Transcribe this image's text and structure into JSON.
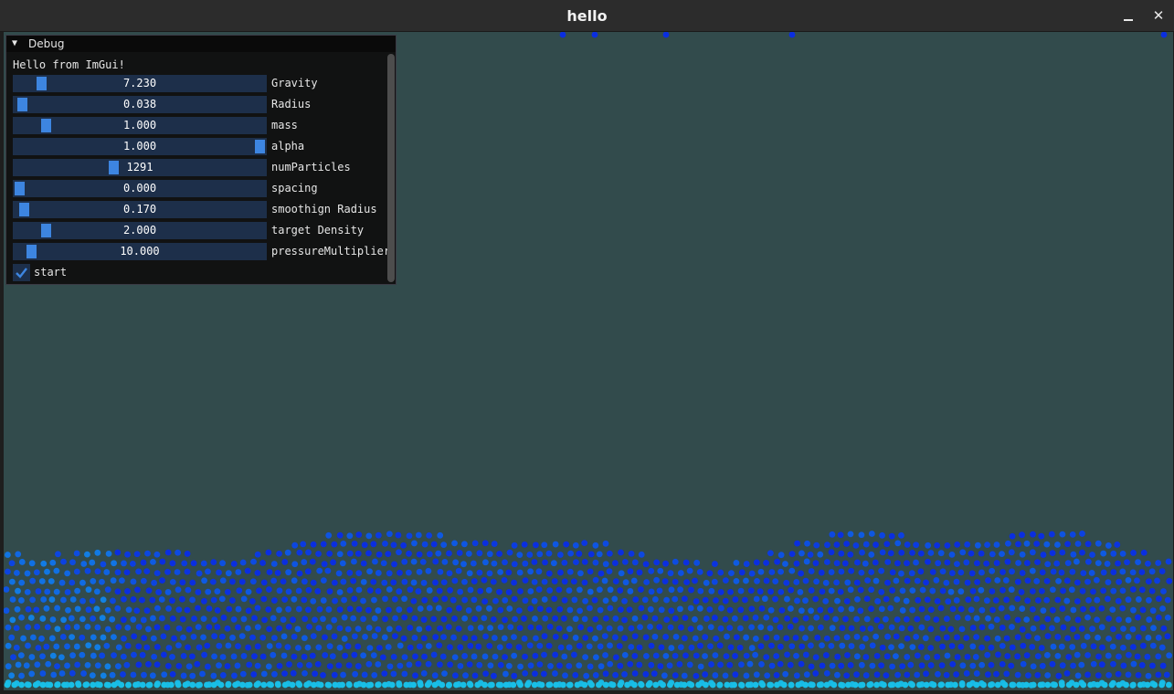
{
  "window": {
    "title": "hello",
    "controls": [
      "minimize-icon",
      "maximize-icon",
      "close-icon"
    ],
    "close_glyph": "✕"
  },
  "colors": {
    "background": "#324b4c",
    "panel": "#0f0f0f",
    "slider_frame": "#1d2f4a",
    "slider_grab": "#3d85e0",
    "particle_slow": "#0a2ee0",
    "particle_fast": "#19c7e6"
  },
  "debug": {
    "title": "Debug",
    "collapse_glyph": "▼",
    "hello_text": "Hello from ImGui!",
    "sliders": [
      {
        "label": "Gravity",
        "value": "7.230",
        "fraction": 0.09
      },
      {
        "label": "Radius",
        "value": "0.038",
        "fraction": 0.01
      },
      {
        "label": "mass",
        "value": "1.000",
        "fraction": 0.11
      },
      {
        "label": "alpha",
        "value": "1.000",
        "fraction": 1.0
      },
      {
        "label": "numParticles",
        "value": "1291",
        "fraction": 0.39
      },
      {
        "label": "spacing",
        "value": "0.000",
        "fraction": 0.0
      },
      {
        "label": "smoothign Radius",
        "value": "0.170",
        "fraction": 0.02
      },
      {
        "label": "target Density",
        "value": "2.000",
        "fraction": 0.11
      },
      {
        "label": "pressureMultiplier",
        "value": "10.000",
        "fraction": 0.05
      }
    ],
    "start": {
      "label": "start",
      "checked": true
    }
  }
}
